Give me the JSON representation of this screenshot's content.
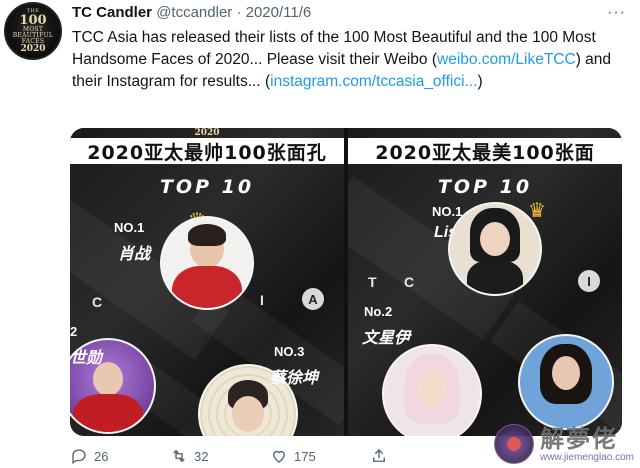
{
  "author": {
    "name": "TC Candler",
    "handle": "@tccandler",
    "separator": "·",
    "date": "2020/11/6",
    "avatar": {
      "line1": "THE",
      "line2": "100",
      "line3": "MOST BEAUTIFUL FACES",
      "line4": "2020"
    }
  },
  "more_icon": "···",
  "tweet": {
    "text_part1": "TCC Asia has released their lists of the 100 Most Beautiful and the 100 Most Handsome Faces of 2020... Please visit their Weibo (",
    "link1": "weibo.com/LikeTCC",
    "text_part2": ") and their Instagram for results...  (",
    "link2": "instagram.com/tccasia_offici...",
    "text_part3": ")"
  },
  "media": {
    "left": {
      "year": "2020",
      "title": "2020亚太最帅100张面孔",
      "subtitle": "TOP 10",
      "no1_label": "NO.1",
      "no1_name": "肖战",
      "no2_label": "2",
      "no2_name": "世勋",
      "no3_label": "NO.3",
      "no3_name": "蔡徐坤",
      "letter_c": "C",
      "letter_i": "I",
      "letter_a": "A"
    },
    "right": {
      "title": "2020亚太最美100张面",
      "subtitle": "TOP 10",
      "no1_label": "NO.1",
      "no1_name": "Lisa",
      "no2_label": "No.2",
      "no2_name": "文星伊",
      "letter_t": "T",
      "letter_c": "C",
      "letter_i": "I"
    }
  },
  "actions": {
    "reply_count": "26",
    "retweet_count": "32",
    "like_count": "175"
  },
  "watermark": {
    "title": "解夢佬",
    "url": "www.jiemenglao.com"
  },
  "colors": {
    "link": "#1d9bf0",
    "muted": "#536471",
    "text": "#0f1419"
  }
}
